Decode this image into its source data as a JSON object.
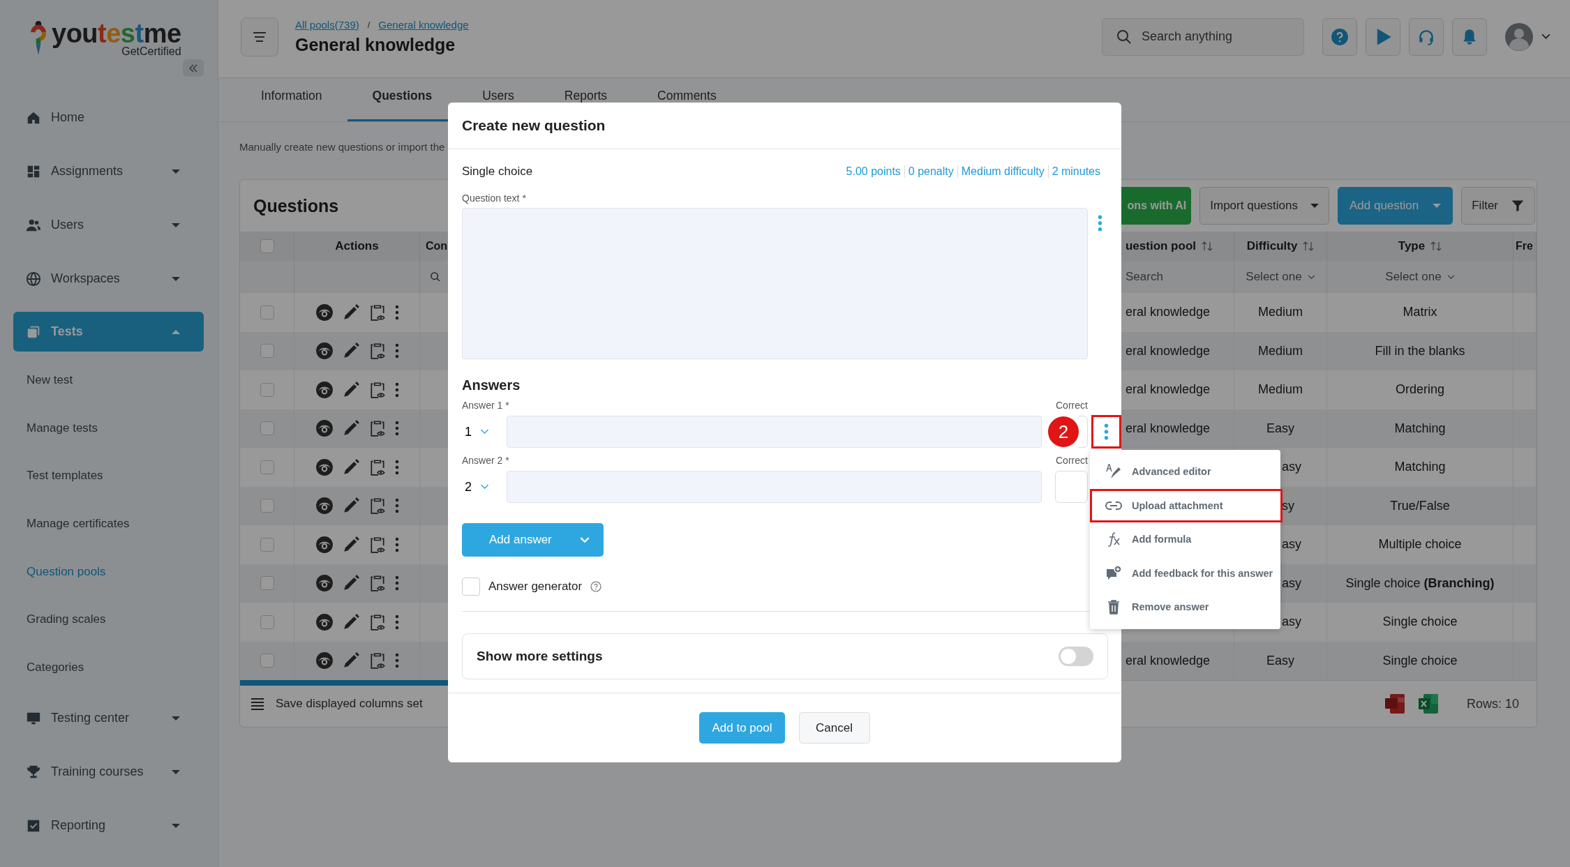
{
  "sidebar": {
    "logo": {
      "parts": [
        {
          "text": "you",
          "color": "#1a1a1a"
        },
        {
          "text": "t",
          "color": "#882a1c"
        },
        {
          "text": "e",
          "color": "#915c13"
        },
        {
          "text": "s",
          "color": "#236433"
        },
        {
          "text": "t",
          "color": "#1c567d"
        },
        {
          "text": "me",
          "color": "#1a1a1a"
        }
      ],
      "tagline": "GetCertified"
    },
    "items": [
      {
        "label": "Home",
        "kind": "link",
        "selected": false
      },
      {
        "label": "Assignments",
        "kind": "group",
        "selected": false,
        "expanded": false
      },
      {
        "label": "Users",
        "kind": "group",
        "selected": false,
        "expanded": false
      },
      {
        "label": "Workspaces",
        "kind": "group",
        "selected": false,
        "expanded": false
      },
      {
        "label": "Tests",
        "kind": "group",
        "selected": true,
        "expanded": true,
        "children": [
          {
            "label": "New test",
            "selected": false
          },
          {
            "label": "Manage tests",
            "selected": false
          },
          {
            "label": "Test templates",
            "selected": false
          },
          {
            "label": "Manage certificates",
            "selected": false
          },
          {
            "label": "Question pools",
            "selected": true
          },
          {
            "label": "Grading scales",
            "selected": false
          },
          {
            "label": "Categories",
            "selected": false
          }
        ]
      },
      {
        "label": "Testing center",
        "kind": "group",
        "selected": false,
        "expanded": false
      },
      {
        "label": "Training courses",
        "kind": "group",
        "selected": false,
        "expanded": false
      },
      {
        "label": "Reporting",
        "kind": "group",
        "selected": false,
        "expanded": false
      }
    ]
  },
  "header": {
    "breadcrumb": [
      "All pools(739)",
      "General knowledge"
    ],
    "separator": "/",
    "title": "General knowledge",
    "search": {
      "placeholder": "Search anything"
    }
  },
  "tabs": [
    {
      "label": "Information",
      "selected": false
    },
    {
      "label": "Questions",
      "selected": true
    },
    {
      "label": "Users",
      "selected": false
    },
    {
      "label": "Reports",
      "selected": false
    },
    {
      "label": "Comments",
      "selected": false
    }
  ],
  "description": "Manually create new questions or import the",
  "questions": {
    "title": "Questions",
    "buttons": [
      {
        "label": "ons with AI",
        "kind": "success"
      },
      {
        "label": "Import questions",
        "kind": "dropdown"
      },
      {
        "label": "Add question",
        "kind": "primary"
      },
      {
        "label": "Filter",
        "kind": "filter"
      }
    ],
    "select_all": {
      "checked": false
    },
    "columns": [
      {
        "label": "Actions",
        "sortable": false
      },
      {
        "label": "Con"
      },
      {
        "label": "uestion pool",
        "sortable": true
      },
      {
        "label": "Difficulty",
        "sortable": true
      },
      {
        "label": "Type",
        "sortable": true
      },
      {
        "label": "Fre"
      }
    ],
    "filters": [
      {
        "placeholder": "Search"
      },
      {
        "placeholder": "Select one"
      },
      {
        "placeholder": "Select one"
      }
    ],
    "rows": [
      {
        "checked": false,
        "pool": "eral knowledge",
        "difficulty": "Medium",
        "type": "Matrix"
      },
      {
        "checked": false,
        "pool": "eral knowledge",
        "difficulty": "Medium",
        "type": "Fill in the blanks"
      },
      {
        "checked": false,
        "pool": "eral knowledge",
        "difficulty": "Medium",
        "type": "Ordering"
      },
      {
        "checked": false,
        "pool": "eral knowledge",
        "difficulty": "Easy",
        "type": "Matching"
      },
      {
        "checked": false,
        "difficulty": "asy",
        "type": "Matching"
      },
      {
        "checked": false,
        "difficulty": "sy",
        "type": "True/False"
      },
      {
        "checked": false,
        "difficulty": "asy",
        "type": "Multiple choice"
      },
      {
        "checked": false,
        "difficulty": "asy",
        "type": "Single choice **(Branching)**"
      },
      {
        "checked": false,
        "difficulty": "asy",
        "type": "Single choice"
      },
      {
        "checked": false,
        "pool": "eral knowledge",
        "difficulty": "Easy",
        "type": "Single choice"
      }
    ],
    "save_columns": "Save displayed columns set",
    "rows_count": "Rows: 10"
  },
  "modal": {
    "title": "Create new question",
    "question_type": "Single choice",
    "meta": [
      "5.00 points",
      "0 penalty",
      "Medium difficulty",
      "2 minutes"
    ],
    "question_label": "Question text *",
    "answers_heading": "Answers",
    "answers": [
      {
        "label": "Answer 1 *",
        "number": "1",
        "correct_label": "Correct",
        "correct": false,
        "badge": "2",
        "menu_highlighted": true
      },
      {
        "label": "Answer 2 *",
        "number": "2",
        "correct_label": "Correct",
        "correct": false
      }
    ],
    "add_answer": "Add answer",
    "answer_generator": {
      "label": "Answer generator",
      "checked": false
    },
    "more_settings": {
      "label": "Show more settings",
      "on": false
    },
    "buttons": [
      {
        "label": "Add to pool",
        "kind": "primary"
      },
      {
        "label": "Cancel",
        "kind": "secondary"
      }
    ]
  },
  "answer_menu": {
    "items": [
      {
        "label": "Advanced editor",
        "highlighted": false
      },
      {
        "label": "Upload attachment",
        "highlighted": true
      },
      {
        "label": "Add formula",
        "highlighted": false
      },
      {
        "label": "Add feedback for this answer",
        "highlighted": false
      },
      {
        "label": "Remove answer",
        "highlighted": false
      }
    ]
  }
}
